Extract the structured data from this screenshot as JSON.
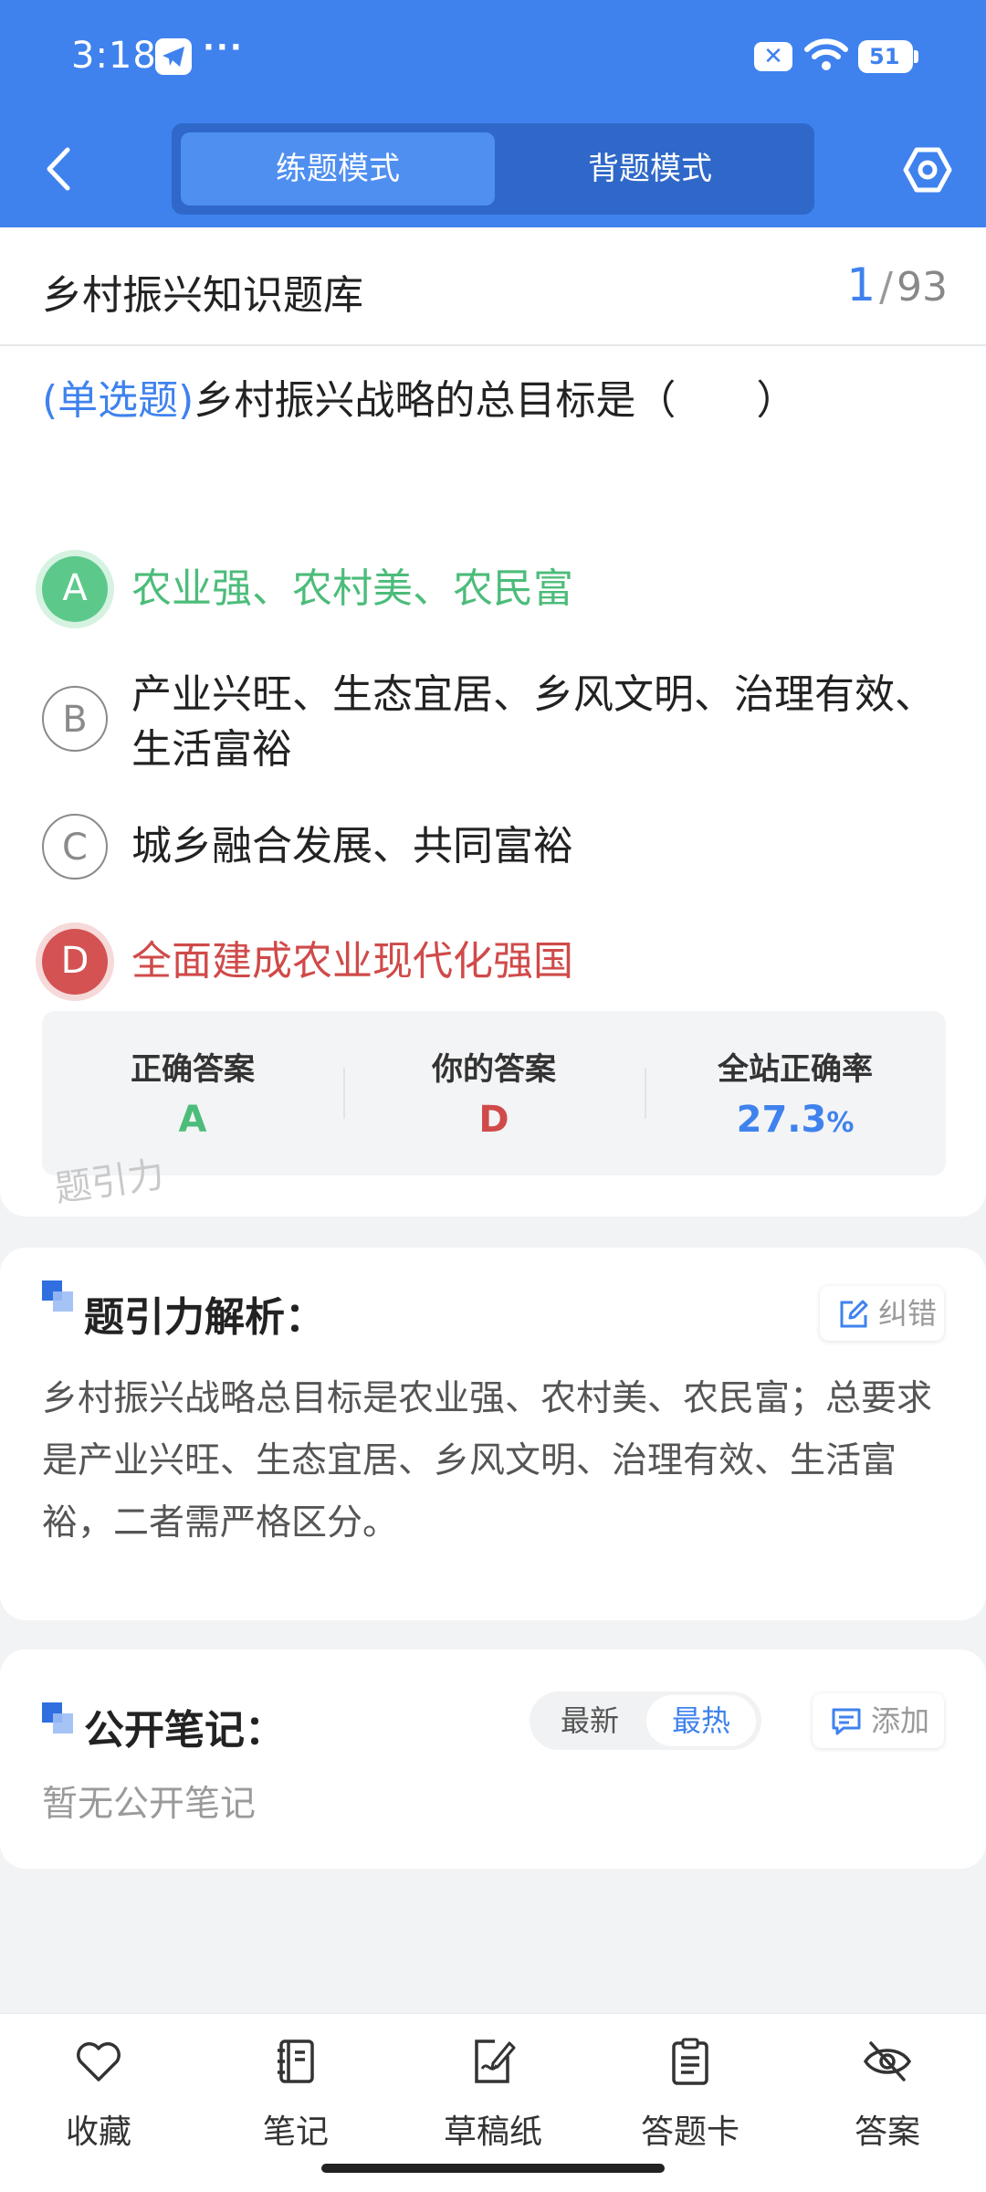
{
  "status_bar": {
    "time": "3:18",
    "more": "···",
    "battery": "51"
  },
  "header": {
    "mode_tabs": [
      {
        "label": "练题模式",
        "active": true
      },
      {
        "label": "背题模式",
        "active": false
      }
    ]
  },
  "question_bank": {
    "title": "乡村振兴知识题库",
    "current": "1",
    "separator": "/",
    "total": "93"
  },
  "question": {
    "type_label": "(单选题)",
    "text": "乡村振兴战略的总目标是（　　）",
    "options": [
      {
        "letter": "A",
        "text": "农业强、农村美、农民富",
        "state": "correct"
      },
      {
        "letter": "B",
        "text": "产业兴旺、生态宜居、乡风文明、治理有效、生活富裕",
        "state": "normal"
      },
      {
        "letter": "C",
        "text": "城乡融合发展、共同富裕",
        "state": "normal"
      },
      {
        "letter": "D",
        "text": "全面建成农业现代化强国",
        "state": "wrong"
      }
    ]
  },
  "stats": {
    "correct_label": "正确答案",
    "correct_value": "A",
    "yours_label": "你的答案",
    "yours_value": "D",
    "rate_label": "全站正确率",
    "rate_value": "27.3",
    "rate_unit": "%"
  },
  "watermark": "题引力",
  "analysis": {
    "title": "题引力解析：",
    "correct_button": "纠错",
    "text": "乡村振兴战略总目标是农业强、农村美、农民富；总要求是产业兴旺、生态宜居、乡风文明、治理有效、生活富裕，二者需严格区分。"
  },
  "notes": {
    "title": "公开笔记：",
    "sort_options": [
      "最新",
      "最热"
    ],
    "sort_selected": "最热",
    "add_button": "添加",
    "empty_text": "暂无公开笔记"
  },
  "bottom_nav": [
    {
      "label": "收藏",
      "icon": "heart-icon"
    },
    {
      "label": "笔记",
      "icon": "notebook-icon"
    },
    {
      "label": "草稿纸",
      "icon": "draft-paper-icon"
    },
    {
      "label": "答题卡",
      "icon": "clipboard-icon"
    },
    {
      "label": "答案",
      "icon": "eye-off-icon"
    }
  ],
  "colors": {
    "primary": "#3f82ee",
    "correct": "#5cc98b",
    "wrong": "#d45252"
  }
}
